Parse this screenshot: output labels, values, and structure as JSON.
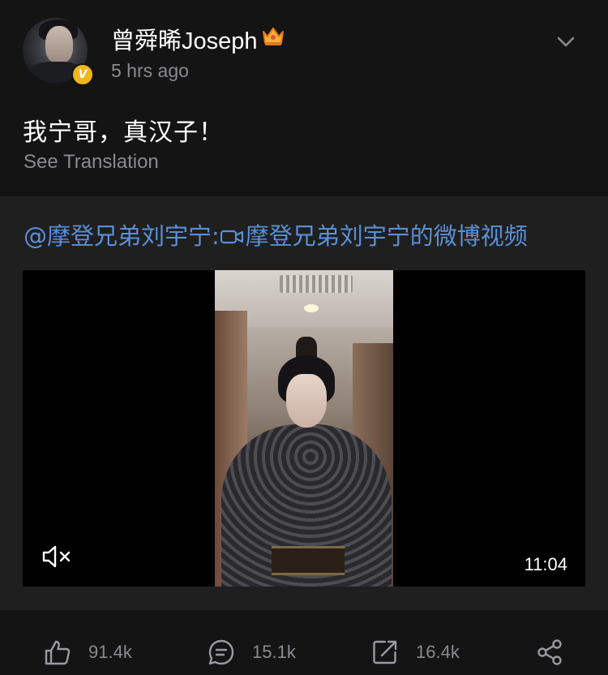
{
  "post": {
    "username": "曾舜晞Joseph",
    "timestamp": "5 hrs ago",
    "verified_badge": "V",
    "text": "我宁哥，真汉子！",
    "see_translation": "See Translation"
  },
  "repost": {
    "mention": "@摩登兄弟刘宇宁:",
    "video_title": "摩登兄弟刘宇宁的微博视频",
    "video_duration": "11:04"
  },
  "actions": {
    "like_count": "91.4k",
    "comment_count": "15.1k",
    "repost_count": "16.4k"
  },
  "icons": [
    "crown-icon",
    "chevron-down-icon",
    "video-camera-icon",
    "mute-icon",
    "like-icon",
    "comment-icon",
    "repost-icon",
    "share-icon"
  ],
  "colors": {
    "background": "#141414",
    "repost_background": "#1f1f1f",
    "link": "#5a8fd6",
    "secondary_text": "#8a8a8f",
    "verified": "#f2b51c"
  }
}
